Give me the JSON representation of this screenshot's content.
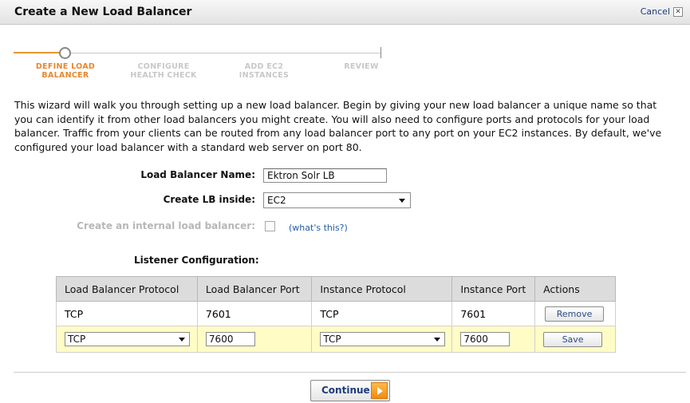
{
  "dialog": {
    "title": "Create a New Load Balancer",
    "cancel_label": "Cancel"
  },
  "wizard": {
    "steps": [
      {
        "line1": "DEFINE LOAD",
        "line2": "BALANCER",
        "state": "active"
      },
      {
        "line1": "CONFIGURE",
        "line2": "HEALTH CHECK",
        "state": "pending"
      },
      {
        "line1": "ADD EC2",
        "line2": "INSTANCES",
        "state": "pending"
      },
      {
        "line1": "REVIEW",
        "line2": "",
        "state": "pending"
      }
    ]
  },
  "intro_text": "This wizard will walk you through setting up a new load balancer. Begin by giving your new load balancer a unique name so that you can identify it from other load balancers you might create. You will also need to configure ports and protocols for your load balancer. Traffic from your clients can be routed from any load balancer port to any port on your EC2 instances. By default, we've configured your load balancer with a standard web server on port 80.",
  "form": {
    "name_label": "Load Balancer Name:",
    "name_value": "Ektron Solr LB",
    "inside_label": "Create LB inside:",
    "inside_value": "EC2",
    "internal_label": "Create an internal load balancer:",
    "internal_checked": false,
    "whats_this": "(what's this?)",
    "listener_label": "Listener Configuration:"
  },
  "listeners": {
    "headers": [
      "Load Balancer Protocol",
      "Load Balancer Port",
      "Instance Protocol",
      "Instance Port",
      "Actions"
    ],
    "rows": [
      {
        "lb_protocol": "TCP",
        "lb_port": "7601",
        "instance_protocol": "TCP",
        "instance_port": "7601",
        "action": "Remove"
      }
    ],
    "edit_row": {
      "lb_protocol": "TCP",
      "lb_port": "7600",
      "instance_protocol": "TCP",
      "instance_port": "7600",
      "action": "Save"
    }
  },
  "footer": {
    "continue_label": "Continue"
  },
  "colors": {
    "accent_orange": "#e8872c",
    "link_blue": "#1f5fa8",
    "edit_row_bg": "#fffcc6"
  }
}
